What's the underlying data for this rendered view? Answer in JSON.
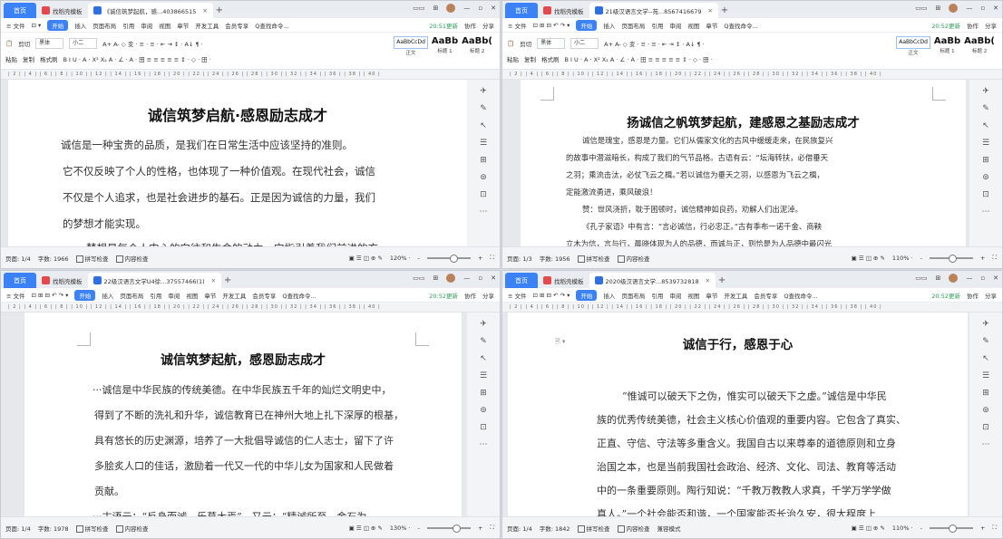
{
  "common": {
    "home_tab": "首页",
    "template_tab": "找稻壳模板",
    "new_tab": "+",
    "menu": {
      "file": "≡ 文件",
      "start": "开始",
      "insert": "插入",
      "layout": "页面布局",
      "reference": "引用",
      "review": "审阅",
      "view": "视图",
      "section": "章节",
      "devtools": "开发工具",
      "member": "会员专享",
      "search": "Q查找命令...",
      "collab": "协作",
      "share": "分享"
    },
    "ribbon": {
      "cut": "剪切",
      "copy": "复制",
      "painter": "格式刷",
      "paste": "粘贴",
      "font": "黑体",
      "size": "小二",
      "style0": "AaBbCcDd",
      "style1": "AaBb",
      "style2": "AaBb(",
      "style0_name": "正文",
      "style1_name": "标题 1",
      "style2_name": "标题 2",
      "format_row1": "A+  A-  ◇  变 ·  ≡ ·  ≡ ·  ⇤  ⇥  ↕ ·  A↓  ¶ ·",
      "format_row2": "B  I  U · A · X²  X₂  A ·  ∠ ·  A ·  田   ≡  ≡  ≡  ≡  ≡  ↕ ·  ◇ ·  田 ·"
    },
    "ruler": "| 2 |   | 4 |   | 6 |   | 8 |   | 10 |   | 12 |   | 14 |   | 16 |   | 18 |   | 20 |   | 22 |   | 24 |   | 26 |   | 28 |   | 30 |   | 32 |   | 34 |   | 36 |   | 38 |   | 40 |",
    "spellcheck": "拼写检查",
    "content_check": "内容检查",
    "side_icons": [
      "✈",
      "✎",
      "↖",
      "☰",
      "⊞",
      "⊚",
      "⊡",
      "⋯"
    ],
    "view_icons": "▣  ☰  ◫  ⊕  ✎",
    "zoom_minus": "-",
    "zoom_plus": "+",
    "expand": "⛶"
  },
  "panes": [
    {
      "tab_title": "《诚信筑梦起航，感...403866515",
      "update": "20:51更新",
      "page": "页面: 1/4",
      "words": "字数: 1966",
      "zoom": "120% ·",
      "zoom_level_pct": 58,
      "title": "诚信筑梦启航·感恩励志成才",
      "paragraphs": [
        "诚信是一种宝贵的品质，是我们在日常生活中应该坚持的准则。",
        "它不仅反映了个人的性格，也体现了一种价值观。在现代社会，诚信",
        "不仅是个人追求，也是社会进步的基石。正是因为诚信的力量，我们",
        "的梦想才能实现。",
        "梦想是每个人内心的向往和生命的动力，它指引着我们前进的方"
      ]
    },
    {
      "tab_title": "21级汉语言文学--苑...8567416679",
      "update": "20:52更新",
      "page": "页面: 1/3",
      "words": "字数: 1956",
      "zoom": "110% ·",
      "zoom_level_pct": 50,
      "title": "扬诚信之帆筑梦起航，建感恩之基励志成才",
      "paragraphs": [
        "诚信是瑰宝，感恩是力量。它们从儒家文化的古风中缓缓走来，在民族复兴",
        "的故事中潜滋暗长，构成了我们的气节品格。古语有云：“坛海转扶，必借垂天",
        "之羽；乘流击汰，必仗飞云之楫。”若以诚信为垂天之羽，以感恩为飞云之楫，",
        "定能激流勇进，乘风破浪！",
        "赞：世风浇折，耽于困顿时，诚信精神如良药，劝解人们出泥淖。",
        "《孔子家语》中有言：“言必诚信，行必忠正。”古有季布一诺千金、商鞅",
        "立木为信，言与行，晨晓体现为人的品德，而诚与正，则恰是为人品德中最闪光"
      ]
    },
    {
      "tab_title": "22级汉语言文学U4徐...37557466(1)",
      "update": "20:52更新",
      "page": "页面: 1/4",
      "words": "字数: 1978",
      "zoom": "130% ·",
      "zoom_level_pct": 64,
      "title": "诚信筑梦起航，感恩励志成才",
      "paragraphs": [
        "···诚信是中华民族的传统美德。在中华民族五千年的灿烂文明史中，",
        "得到了不断的洗礼和升华，诚信教育已在神州大地上扎下深厚的根基，",
        "具有悠长的历史渊源，培养了一大批倡导诚信的仁人志士，留下了许",
        "多脍炙人口的佳话，激励着一代又一代的中华儿女为国家和人民做着",
        "贡献。",
        "···古语云：“反身而诚，乐莫大焉”，又云：“精诚所至，金石为"
      ]
    },
    {
      "tab_title": "2020级汉语言文学...8539732818",
      "update": "20:52更新",
      "page": "页面: 1/4",
      "words": "字数: 1842",
      "extra": "兼容模式",
      "zoom": "110% ·",
      "zoom_level_pct": 50,
      "title": "诚信于行，感恩于心",
      "paragraphs": [
        "“惟诚可以破天下之伪，惟实可以破天下之虚。”诚信是中华民",
        "族的优秀传统美德，社会主义核心价值观的重要内容。它包含了真实、",
        "正直、守信、守法等多重含义。我国自古以来尊奉的道德原则和立身",
        "治国之本，也是当前我国社会政治、经济、文化、司法、教育等活动",
        "中的一条重要原则。陶行知说：“千教万教教人求真，千学万学学做",
        "真人。”一个社会能否和谐，一个国家能否长治久安，很大程度上"
      ]
    }
  ]
}
